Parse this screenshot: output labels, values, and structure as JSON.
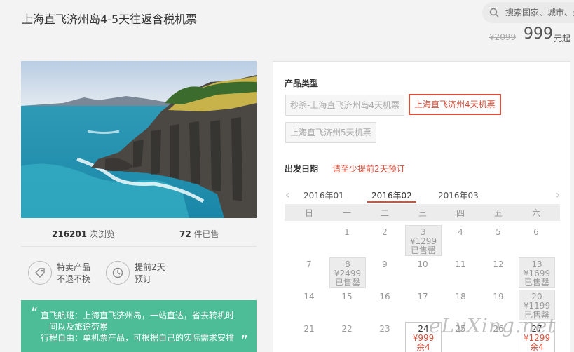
{
  "header": {
    "title": "上海直飞济州岛4-5天往返含税机票",
    "search_placeholder": "搜索国家、城市、景"
  },
  "price": {
    "old": "¥2099",
    "current": "999",
    "unit": "元起"
  },
  "stats": {
    "views_num": "216201",
    "views_label": "次浏览",
    "sold_num": "72",
    "sold_label": "件已售"
  },
  "features": [
    {
      "icon": "tag-icon",
      "line1": "特卖产品",
      "line2": "不退不换"
    },
    {
      "icon": "clock-icon",
      "line1": "提前2天",
      "line2": "预订"
    }
  ],
  "intro": {
    "line1": "直飞航班：上海直飞济州岛，一站直达，省去转机时",
    "line2": "间以及旅途劳累",
    "line3": "行程自由：单机票产品，可根据自己的实际需求安排"
  },
  "booking": {
    "type_label": "产品类型",
    "types": [
      "秒杀-上海直飞济州岛4天机票",
      "上海直飞济州4天机票",
      "上海直飞济州5天机票"
    ],
    "date_label": "出发日期",
    "date_note": "请至少提前2天预订",
    "months": [
      "2016年01",
      "2016年02",
      "2016年03"
    ],
    "weekdays": [
      "日",
      "一",
      "二",
      "三",
      "四",
      "五",
      "六"
    ],
    "days": {
      "d1": "1",
      "d2": "2",
      "d3": "3",
      "d3_price": "¥1299",
      "d3_status": "已售罄",
      "d4": "4",
      "d5": "5",
      "d6": "6",
      "d7": "7",
      "d8": "8",
      "d8_price": "¥2499",
      "d8_status": "已售罄",
      "d9": "9",
      "d10": "10",
      "d11": "11",
      "d12": "12",
      "d13": "13",
      "d13_price": "¥1699",
      "d13_status": "已售罄",
      "d14": "14",
      "d15": "15",
      "d16": "16",
      "d17": "17",
      "d18": "18",
      "d19": "19",
      "d20": "20",
      "d20_price": "¥1199",
      "d20_status": "已售罄",
      "d21": "21",
      "d22": "22",
      "d23": "23",
      "d24": "24",
      "d24_price": "¥999",
      "d24_status": "余4",
      "d25": "25",
      "d26": "26",
      "d27": "27",
      "d27_price": "¥1299",
      "d27_status": "余4"
    }
  },
  "watermark": "eLvXing.net",
  "colors": {
    "accent": "#d94f3b",
    "green": "#4dbd97"
  }
}
